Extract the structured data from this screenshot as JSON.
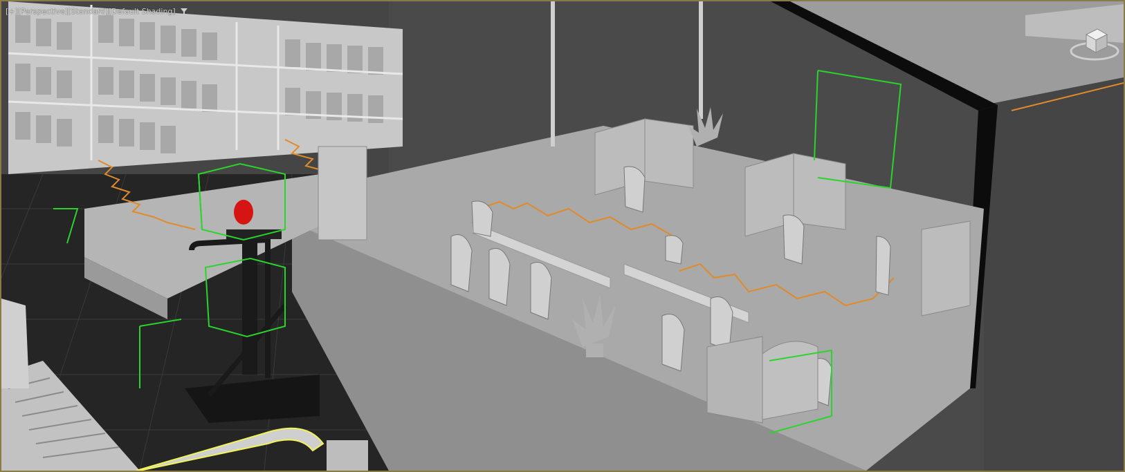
{
  "viewport": {
    "labels": [
      "[+]",
      "[Perspective]",
      "[Standard]",
      "[Default Shading]"
    ],
    "filter_icon": "filter-icon",
    "viewcube_icon": "viewcube-icon"
  },
  "colors": {
    "frame_border": "#8a7a45",
    "selection_green": "#2bd42b",
    "selected_yellow": "#f2f25a",
    "path_orange": "#e08a2a",
    "beacon_red": "#d61414",
    "floor_dark": "#252525",
    "background": "#444444"
  }
}
